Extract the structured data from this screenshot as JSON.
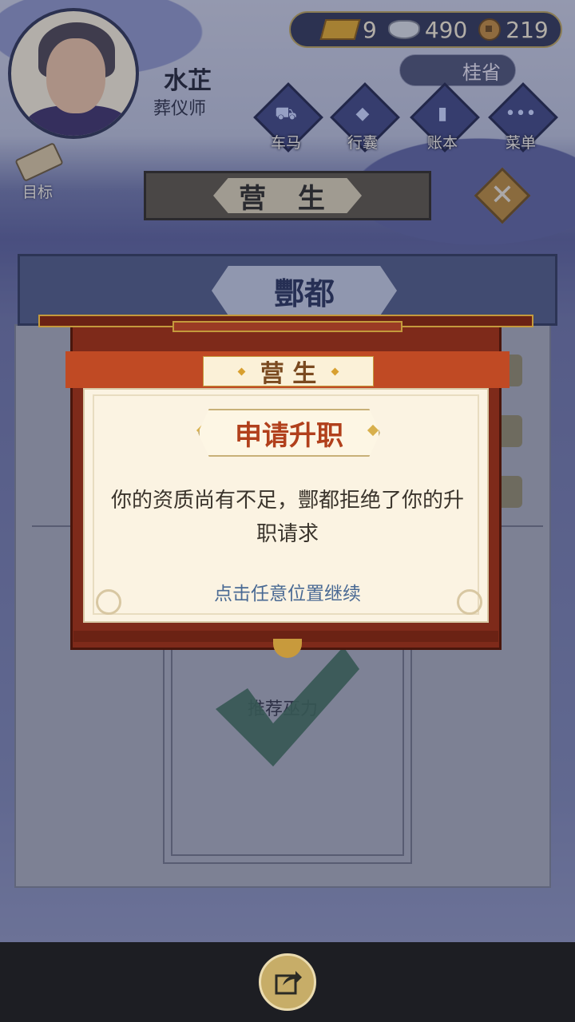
{
  "player": {
    "name": "水芷",
    "title": "葬仪师"
  },
  "currency": {
    "gold": "9",
    "silver": "490",
    "copper": "219"
  },
  "location": "桂省",
  "menu": [
    {
      "label": "车马",
      "icon": "carriage-icon"
    },
    {
      "label": "行囊",
      "icon": "bag-icon"
    },
    {
      "label": "账本",
      "icon": "ledger-icon"
    },
    {
      "label": "菜单",
      "icon": "more-icon"
    }
  ],
  "goal": {
    "label": "目标"
  },
  "banner": {
    "title": "营 生"
  },
  "city": {
    "name": "酆都"
  },
  "doc": {
    "recommend": "推荐巫力"
  },
  "dialog": {
    "header": "营 生",
    "title": "申请升职",
    "message": "你的资质尚有不足，酆都拒绝了你的升职请求",
    "continue": "点击任意位置继续"
  },
  "colors": {
    "accent": "#b1401c",
    "frame": "#7e2a1a",
    "gold": "#c49a3c",
    "link": "#4a6a94"
  }
}
